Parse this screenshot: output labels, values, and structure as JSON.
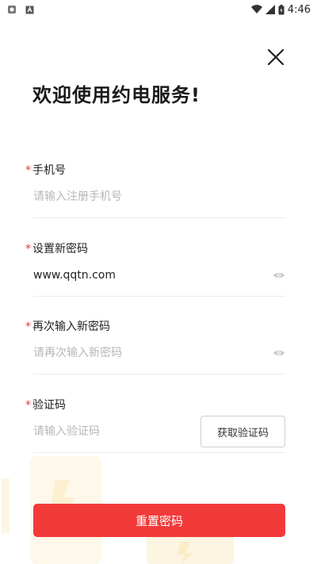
{
  "status_bar": {
    "time": "4:46",
    "left_icons": [
      "notification-icon",
      "app-a-icon"
    ],
    "right_icons": [
      "wifi-icon",
      "signal-icon",
      "battery-icon"
    ]
  },
  "header": {
    "title": "欢迎使用约电服务!"
  },
  "form": {
    "phone": {
      "required_mark": "*",
      "label": "手机号",
      "placeholder": "请输入注册手机号",
      "value": ""
    },
    "new_password": {
      "required_mark": "*",
      "label": "设置新密码",
      "placeholder": "",
      "value": "www.qqtn.com"
    },
    "confirm_password": {
      "required_mark": "*",
      "label": "再次输入新密码",
      "placeholder": "请再次输入新密码",
      "value": ""
    },
    "code": {
      "required_mark": "*",
      "label": "验证码",
      "placeholder": "请输入验证码",
      "value": "",
      "button_label": "获取验证码"
    },
    "submit_label": "重置密码"
  },
  "colors": {
    "accent": "#f23a3a",
    "required": "#e53935",
    "placeholder": "#b7b7b7",
    "divider": "#ececec"
  }
}
